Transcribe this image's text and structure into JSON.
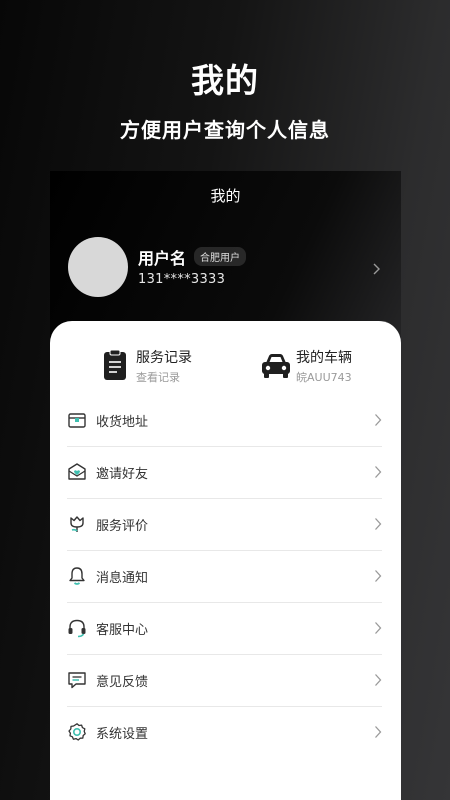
{
  "promo": {
    "title": "我的",
    "subtitle": "方便用户查询个人信息"
  },
  "screen": {
    "title": "我的"
  },
  "profile": {
    "username": "用户名",
    "badge": "合肥用户",
    "phone": "131****3333"
  },
  "quick": {
    "service_records": {
      "label": "服务记录",
      "sub": "查看记录",
      "icon": "clipboard-icon"
    },
    "my_vehicle": {
      "label": "我的车辆",
      "sub": "皖AUU743",
      "icon": "car-icon"
    }
  },
  "menu": [
    {
      "label": "收货地址",
      "icon": "address-box-icon"
    },
    {
      "label": "邀请好友",
      "icon": "invite-envelope-icon"
    },
    {
      "label": "服务评价",
      "icon": "tulip-icon"
    },
    {
      "label": "消息通知",
      "icon": "bell-icon"
    },
    {
      "label": "客服中心",
      "icon": "headset-icon"
    },
    {
      "label": "意见反馈",
      "icon": "feedback-chat-icon"
    },
    {
      "label": "系统设置",
      "icon": "settings-gear-icon"
    }
  ],
  "colors": {
    "accent_teal": "#3fbfb0",
    "icon_dark": "#333333",
    "card_bg": "#ffffff"
  }
}
